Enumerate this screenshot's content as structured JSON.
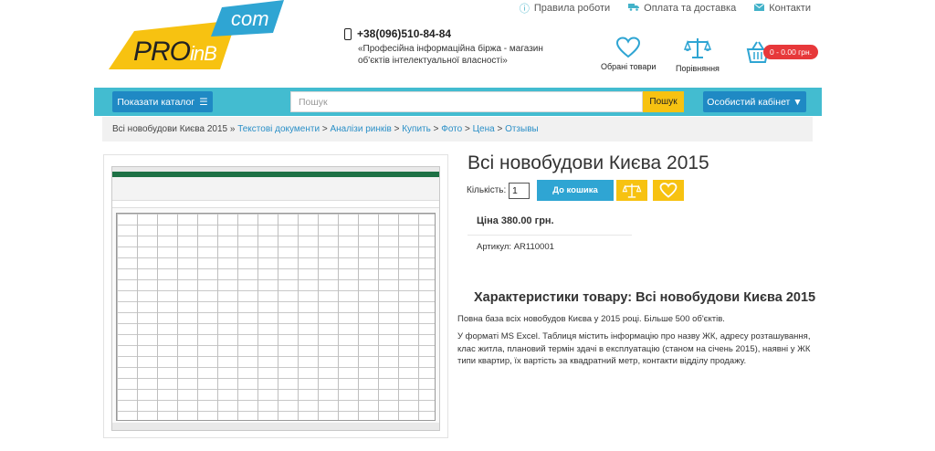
{
  "top_links": [
    {
      "icon": "info-circle-icon",
      "label": "Правила роботи"
    },
    {
      "icon": "truck-icon",
      "label": "Оплата та доставка"
    },
    {
      "icon": "envelope-icon",
      "label": "Контакти"
    }
  ],
  "logo": {
    "main": "PRO",
    "inb": "inB",
    "com": "com"
  },
  "contact": {
    "phone": "+38(096)510-84-84",
    "description": "«Професійна інформаційна біржа - магазин об'єктів інтелектуальної власності»"
  },
  "header_icons": {
    "favorites": "Обрані товари",
    "compare": "Порівняння",
    "cart_badge": "0 - 0.00 грн."
  },
  "nav": {
    "catalog_label": "Показати каталог",
    "search_placeholder": "Пошук",
    "search_button": "Пошук",
    "cabinet_label": "Особистий кабінет ▼"
  },
  "breadcrumb": {
    "current": "Всі новобудови Києва 2015",
    "links": [
      "Текстові документи",
      "Аналізи ринків",
      "Купить",
      "Фото",
      "Цена",
      "Отзывы"
    ]
  },
  "product": {
    "title": "Всі новобудови Києва 2015",
    "qty_label": "Кількість:",
    "qty_value": "1",
    "add_to_cart": "До кошика",
    "price": "Ціна 380.00 грн.",
    "article": "Артикул: AR110001"
  },
  "characteristics": {
    "title": "Характеристики товару: Всі новобудови Києва 2015",
    "paragraph1": "Повна база всіх новобудов Києва у 2015 році. Більше 500 об'єктів.",
    "paragraph2": "У форматі MS Excel. Таблиця містить інформацію про назву ЖК, адресу розташування, клас житла, плановий термін здачі в експлуатацію (станом на січень 2015), наявні у ЖК типи квартир, їх вартість за квадратний метр, контакти відділу продажу."
  },
  "colors": {
    "nav_bg": "#43bcd0",
    "button_blue": "#1f89c4",
    "accent_yellow": "#f7c211",
    "badge_red": "#e7383a",
    "link": "#2a8fc7"
  }
}
